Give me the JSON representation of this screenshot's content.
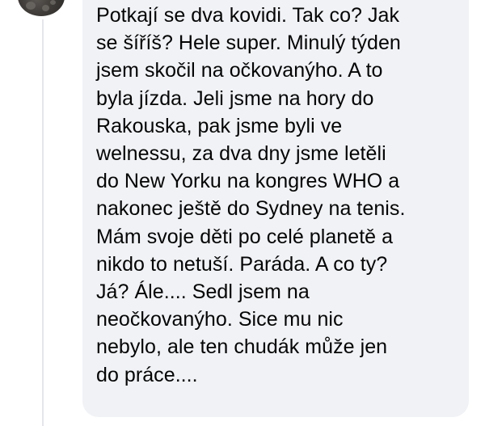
{
  "comment": {
    "lines": [
      "Potkají se dva kovidi. Tak co? Jak",
      "se šíříš? Hele super. Minulý týden",
      "jsem skočil na očkovanýho. A to",
      "byla jízda. Jeli jsme na hory do",
      "Rakouska, pak jsme byli ve",
      "welnessu, za dva dny jsme letěli",
      "do New Yorku na kongres WHO a",
      "nakonec ještě do Sydney na tenis.",
      "Mám svoje děti po celé planetě a",
      "nikdo to netuší. Paráda. A co ty?",
      "Já? Ále.... Sedl jsem na",
      "neočkovanýho. Sice mu nic",
      "nebylo, ale ten chudák může jen",
      "do práce...."
    ]
  },
  "colors": {
    "bubble_background": "#f0f2f5",
    "text": "#050505",
    "thread_line": "#e4e6eb"
  }
}
